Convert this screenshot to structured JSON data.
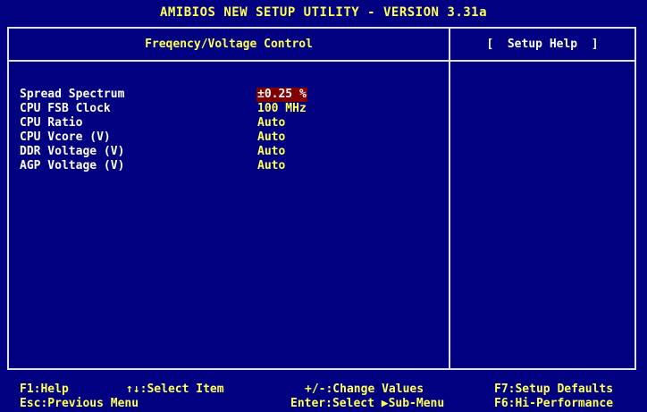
{
  "title": "AMIBIOS NEW SETUP UTILITY - VERSION 3.31a",
  "panel_title": "Freqency/Voltage Control",
  "help_title": "[  Setup Help  ]",
  "settings": [
    {
      "label": "Spread Spectrum",
      "value": "±0.25 %",
      "selected": true
    },
    {
      "label": "CPU FSB Clock",
      "value": "100 MHz",
      "selected": false
    },
    {
      "label": "CPU Ratio",
      "value": "Auto",
      "selected": false
    },
    {
      "label": "CPU Vcore (V)",
      "value": "Auto",
      "selected": false
    },
    {
      "label": "DDR Voltage (V)",
      "value": "Auto",
      "selected": false
    },
    {
      "label": "AGP Voltage (V)",
      "value": "Auto",
      "selected": false
    }
  ],
  "footer": {
    "help": "F1:Help",
    "select_item": "↑↓:Select Item",
    "change_values": "+/-:Change Values",
    "setup_defaults": "F7:Setup Defaults",
    "previous_menu": "Esc:Previous Menu",
    "select_submenu": "Enter:Select ▶Sub-Menu",
    "hi_performance": "F6:Hi-Performance"
  },
  "colors": {
    "background": "#000080",
    "highlight_text": "#ffff55",
    "selected_bg": "#800000",
    "border": "#e0e0e0"
  }
}
